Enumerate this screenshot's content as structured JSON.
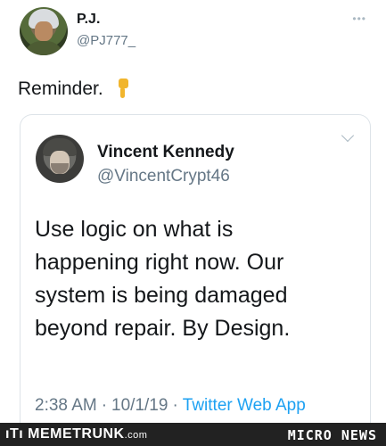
{
  "tweet": {
    "author_name": "P.J.",
    "author_handle": "@PJ777_",
    "more_icon": "more-icon",
    "text": "Reminder.",
    "emoji": "pointing-down-emoji"
  },
  "quoted": {
    "author_name": "Vincent Kennedy",
    "author_handle": "@VincentCrypt46",
    "text": "Use logic on what is\nhappening right now. Our\nsystem is being damaged\nbeyond repair. By Design.",
    "time": "2:38 AM",
    "date": "10/1/19",
    "separator": "·",
    "source_app": "Twitter Web App"
  },
  "footer": {
    "left_brand": "ıTı MEMETRUNK",
    "left_brand_suffix": ".com",
    "right_brand": "MICRO NEWS"
  },
  "colors": {
    "text": "#14171a",
    "secondary": "#657786",
    "link": "#1da1f2",
    "border": "#dde3e8",
    "footer_bg": "#222222"
  }
}
